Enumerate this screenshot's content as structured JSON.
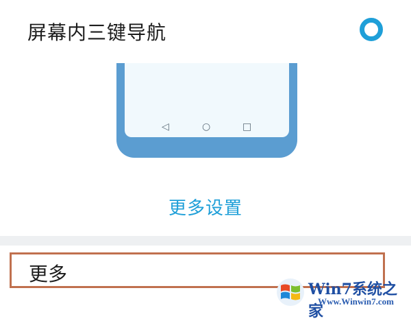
{
  "option": {
    "title": "屏幕内三键导航",
    "selected": true
  },
  "preview": {
    "nav_buttons": [
      "◁",
      "○",
      "□"
    ]
  },
  "more_settings_link": "更多设置",
  "more_section": {
    "label": "更多"
  },
  "watermark": {
    "brand": "Win7系统之家",
    "url": "Www.Winwin7.com"
  },
  "colors": {
    "accent": "#1f9fd8",
    "phone_frame": "#5b9dd1",
    "highlight_border": "#c0704e"
  }
}
